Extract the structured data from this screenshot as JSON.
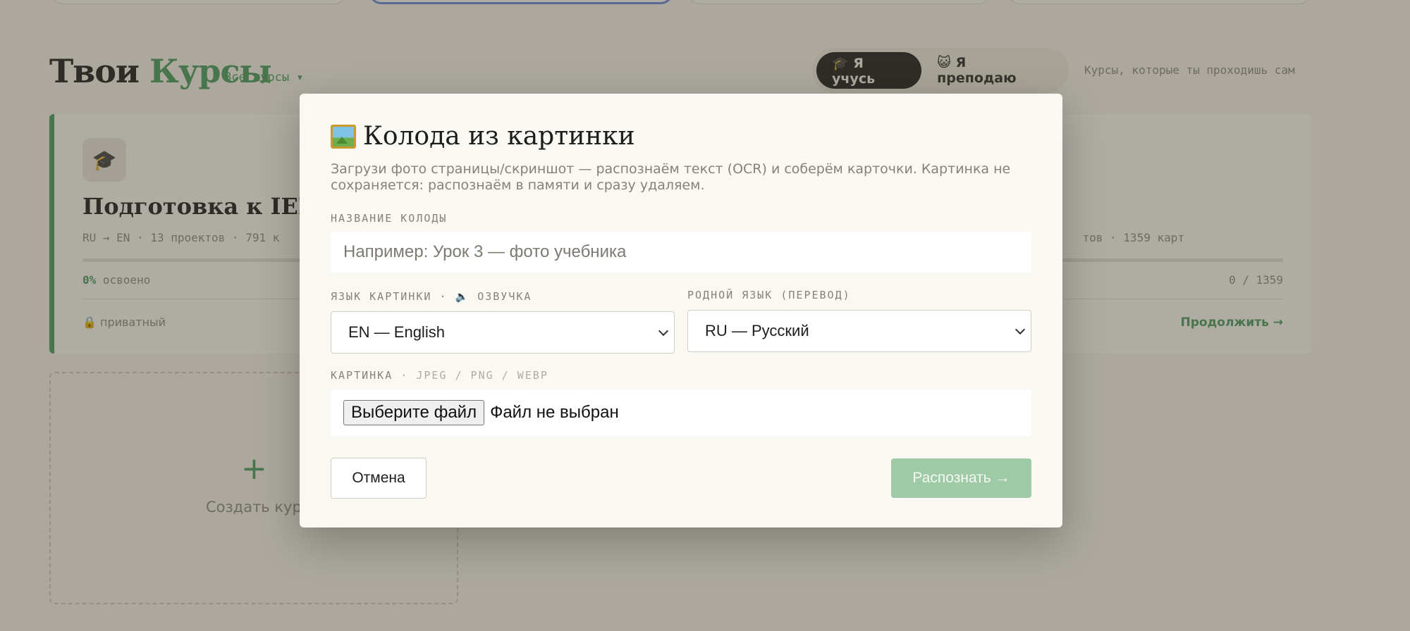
{
  "background": {
    "title_main": "Твои",
    "title_accent": "Курсы",
    "all_courses": "Все курсы ▾",
    "role_learn": "🎓 Я учусь",
    "role_teach": "😺 Я преподаю",
    "role_hint": "Курсы, которые ты проходишь сам",
    "course": {
      "avatar": "🎓",
      "name": "Подготовка к IELTS (",
      "meta": "RU → EN · 13 проектов · 791 к",
      "meta_right": "тов · 1359 карт",
      "progress_pct": "0%",
      "progress_label": " освоено",
      "count": "0 / 1359",
      "private": "🔒 приватный",
      "continue": "Продолжить →"
    },
    "create": {
      "plus": "+",
      "label": "Создать курс"
    }
  },
  "modal": {
    "title": "Колода из картинки",
    "title_icon": "framed-picture-icon",
    "description": "Загрузи фото страницы/скриншот — распознаём текст (OCR) и соберём карточки. Картинка не сохраняется: распознаём в памяти и сразу удаляем.",
    "deck_name_label": "НАЗВАНИЕ КОЛОДЫ",
    "deck_name_placeholder": "Например: Урок 3 — фото учебника",
    "deck_name_value": "",
    "image_lang_label": "ЯЗЫК КАРТИНКИ · 🔈 ОЗВУЧКА",
    "image_lang_value": "EN — English",
    "native_lang_label": "РОДНОЙ ЯЗЫК (ПЕРЕВОД)",
    "native_lang_value": "RU — Русский",
    "image_label": "КАРТИНКА",
    "image_formats": " · JPEG / PNG / WEBP",
    "file_button": "Выберите файл",
    "file_status": "Файл не выбран",
    "cancel": "Отмена",
    "submit": "Распознать →"
  },
  "colors": {
    "accent": "#4a9a5c",
    "submit_disabled": "#9fcaa6",
    "modal_bg": "#f9f8f3"
  }
}
